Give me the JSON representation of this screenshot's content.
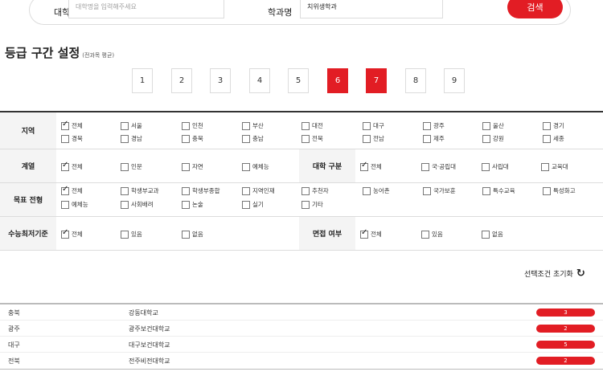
{
  "search": {
    "university_label": "대학명",
    "university_placeholder": "대학명을 입력해주세요",
    "department_label": "학과명",
    "department_value": "치위생학과",
    "search_button": "검색"
  },
  "grade": {
    "title": "등급 구간 설정",
    "subtitle": "(전과목 평균)",
    "buttons": [
      "1",
      "2",
      "3",
      "4",
      "5",
      "6",
      "7",
      "8",
      "9"
    ],
    "active": [
      6,
      7
    ]
  },
  "filters": {
    "region": {
      "label": "지역",
      "options": [
        "전체",
        "서울",
        "인천",
        "부산",
        "대전",
        "대구",
        "광주",
        "울산",
        "경기",
        "경북",
        "경남",
        "충북",
        "충남",
        "전북",
        "전남",
        "제주",
        "강원",
        "세종"
      ],
      "checked": [
        "전체"
      ]
    },
    "track": {
      "label": "계열",
      "options": [
        "전체",
        "인문",
        "자연",
        "예체능"
      ],
      "checked": [
        "전체"
      ]
    },
    "univ_type": {
      "label": "대학 구분",
      "options": [
        "전체",
        "국·공립대",
        "사립대",
        "교육대"
      ],
      "checked": [
        "전체"
      ]
    },
    "admission": {
      "label": "목표 전형",
      "options": [
        "전체",
        "학생부교과",
        "학생부종합",
        "지역인재",
        "추천자",
        "농어촌",
        "국가보훈",
        "특수교육",
        "특성화고",
        "예체능",
        "사회배려",
        "논술",
        "실기",
        "기타"
      ],
      "checked": [
        "전체"
      ]
    },
    "csat_min": {
      "label": "수능최저기준",
      "options": [
        "전체",
        "있음",
        "없음"
      ],
      "checked": [
        "전체"
      ]
    },
    "interview": {
      "label": "면접 여부",
      "options": [
        "전체",
        "있음",
        "없음"
      ],
      "checked": [
        "전체"
      ]
    }
  },
  "reset_label": "선택조건 초기화",
  "results": [
    {
      "region": "충북",
      "name": "강동대학교",
      "count": "3"
    },
    {
      "region": "광주",
      "name": "광주보건대학교",
      "count": "2"
    },
    {
      "region": "대구",
      "name": "대구보건대학교",
      "count": "5"
    },
    {
      "region": "전북",
      "name": "전주비전대학교",
      "count": "2"
    }
  ]
}
